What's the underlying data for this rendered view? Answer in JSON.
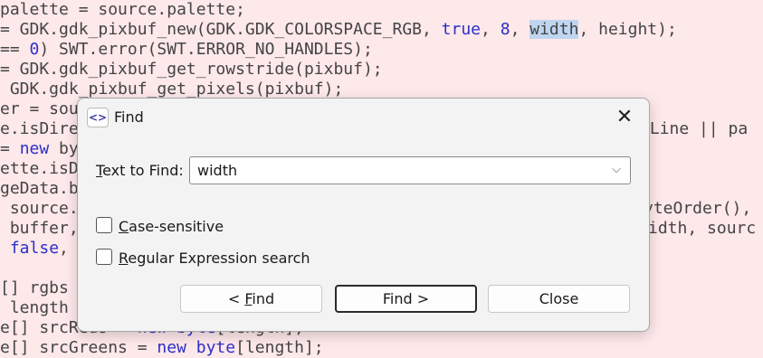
{
  "editor": {
    "lines": [
      [
        [
          "t",
          "palette = source.palette;"
        ]
      ],
      [
        [
          "t",
          "= GDK.gdk_pixbuf_new(GDK.GDK_COLORSPACE_RGB, "
        ],
        [
          "k",
          "true"
        ],
        [
          "t",
          ", "
        ],
        [
          "n",
          "8"
        ],
        [
          "t",
          ", "
        ],
        [
          "s",
          "width"
        ],
        [
          "t",
          ", height);"
        ]
      ],
      [
        [
          "t",
          "== "
        ],
        [
          "n",
          "0"
        ],
        [
          "t",
          ") SWT.error(SWT.ERROR_NO_HANDLES);"
        ]
      ],
      [
        [
          "t",
          "= GDK.gdk_pixbuf_get_rowstride(pixbuf);"
        ]
      ],
      [
        [
          "t",
          " GDK.gdk_pixbuf_get_pixels(pixbuf);"
        ]
      ],
      [
        [
          "t",
          "er = sou"
        ]
      ],
      [
        [
          "t",
          "e.isDire"
        ]
      ],
      [
        [
          "t",
          "= "
        ],
        [
          "k",
          "new"
        ],
        [
          "t",
          " by"
        ]
      ],
      [
        [
          "t",
          "ette.isD"
        ]
      ],
      [
        [
          "t",
          "geData.b"
        ]
      ],
      [
        [
          "t",
          " source."
        ]
      ],
      [
        [
          "t",
          " buffer,"
        ]
      ],
      [
        [
          "t",
          " "
        ],
        [
          "k",
          "false"
        ],
        [
          "t",
          ","
        ]
      ],
      [
        [
          "t",
          ""
        ]
      ],
      [
        [
          "t",
          "[] rgbs"
        ]
      ],
      [
        [
          "t",
          " length"
        ]
      ],
      [
        [
          "t",
          "e[] srcReds = "
        ],
        [
          "k",
          "new"
        ],
        [
          "t",
          " "
        ],
        [
          "k",
          "byte"
        ],
        [
          "t",
          "[length];"
        ]
      ],
      [
        [
          "t",
          "e[] srcGreens = "
        ],
        [
          "k",
          "new"
        ],
        [
          "t",
          " "
        ],
        [
          "k",
          "byte"
        ],
        [
          "t",
          "[length];"
        ]
      ]
    ],
    "right_fragments": [
      "rLine || pa",
      "yteOrder(),",
      "idth, sourc"
    ]
  },
  "dialog": {
    "icon_glyph": "<>",
    "title": "Find",
    "close_glyph": "✕",
    "text_to_find_label_key": "T",
    "text_to_find_label_rest": "ext to Find:",
    "search_value": "width",
    "dropdown_glyph": "⌵",
    "case_label_key": "C",
    "case_label_rest": "ase-sensitive",
    "case_checked": false,
    "regex_label_key": "R",
    "regex_label_rest": "egular Expression search",
    "regex_checked": false,
    "find_prev_label_pre": "< ",
    "find_prev_label_key": "F",
    "find_prev_label_rest": "ind",
    "find_next_label": "Find >",
    "close_label": "Close"
  }
}
